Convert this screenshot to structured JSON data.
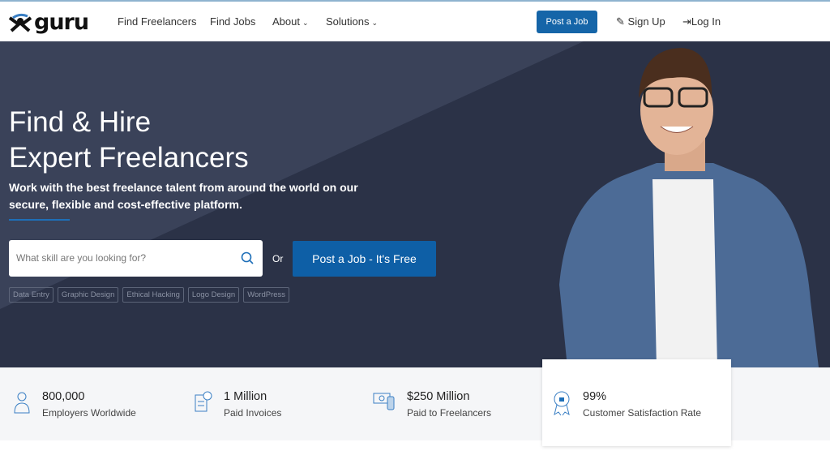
{
  "nav": {
    "logo": "guru",
    "links": [
      "Find Freelancers",
      "Find Jobs",
      "About",
      "Solutions"
    ],
    "post_job": "Post a Job",
    "sign_up": "Sign Up",
    "log_in": "Log In"
  },
  "hero": {
    "title_line1": "Find & Hire",
    "title_line2": "Expert Freelancers",
    "subtitle": "Work with the best freelance talent from around the world on our secure, flexible and cost-effective platform.",
    "search_placeholder": "What skill are you looking for?",
    "or": "Or",
    "cta": "Post a Job - It's Free",
    "tags": [
      "Data Entry",
      "Graphic Design",
      "Ethical Hacking",
      "Logo Design",
      "WordPress"
    ]
  },
  "stats": [
    {
      "value": "800,000",
      "label": "Employers Worldwide",
      "icon": "employer-icon"
    },
    {
      "value": "1 Million",
      "label": "Paid Invoices",
      "icon": "invoice-icon"
    },
    {
      "value": "$250 Million",
      "label": "Paid to Freelancers",
      "icon": "money-icon"
    },
    {
      "value": "99%",
      "label": "Customer Satisfaction Rate",
      "icon": "award-badge-icon"
    }
  ],
  "colors": {
    "brand_blue": "#1565a8",
    "hero_bg": "#2b3247"
  }
}
